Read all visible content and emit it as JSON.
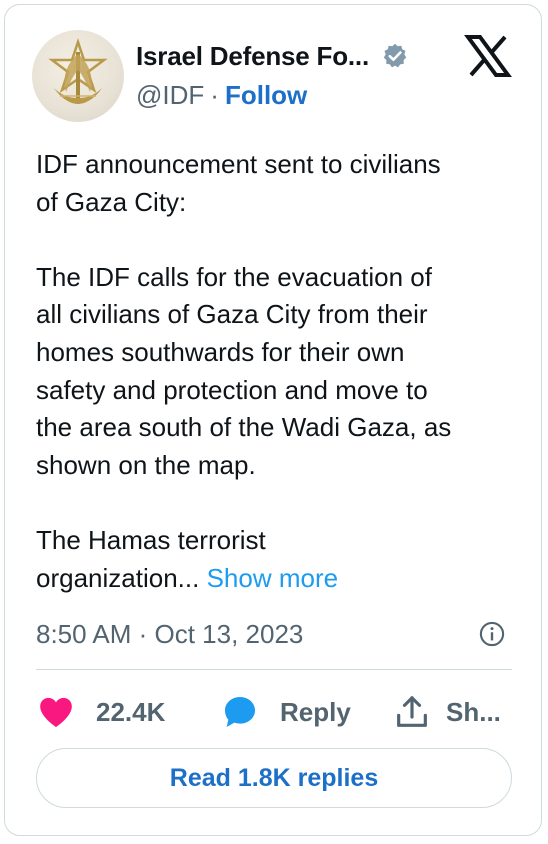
{
  "tweet": {
    "author_name": "Israel Defense Fo...",
    "handle": "@IDF",
    "separator": "·",
    "follow_label": "Follow",
    "paragraphs": [
      [
        "IDF announcement sent to civilians",
        "of Gaza City:"
      ],
      [
        "The IDF calls for the evacuation of",
        "all civilians of Gaza City from their",
        "homes southwards for their own",
        "safety and protection and move to",
        "the area south of the Wadi Gaza, as",
        "shown on the map."
      ]
    ],
    "last_line_1": "The Hamas terrorist",
    "last_line_2": "organization...",
    "show_more_label": "Show more",
    "timestamp": "8:50 AM · Oct 13, 2023"
  },
  "actions": {
    "like_count": "22.4K",
    "reply_label": "Reply",
    "share_label": "Sh..."
  },
  "read_replies_label": "Read 1.8K replies",
  "colors": {
    "link_blue": "#1d9bf0",
    "like_pink": "#f91880",
    "reply_blue": "#1d9bf0",
    "verified_gray": "#829aab",
    "text_secondary": "#536471"
  }
}
